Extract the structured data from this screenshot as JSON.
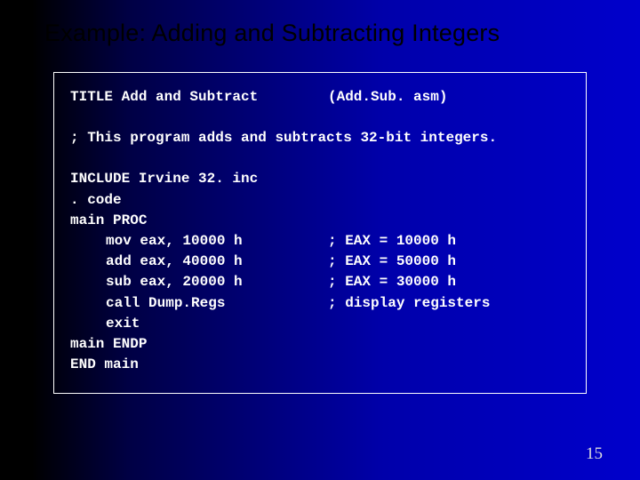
{
  "title": "Example: Adding and Subtracting Integers",
  "code": {
    "line1": {
      "left": "TITLE Add and Subtract",
      "right": "(Add.Sub. asm)"
    },
    "line2": "; This program adds and subtracts 32-bit integers.",
    "line3": "INCLUDE Irvine 32. inc",
    "line4": ". code",
    "line5": "main PROC",
    "line6": {
      "left": "mov eax, 10000 h",
      "right": "; EAX = 10000 h"
    },
    "line7": {
      "left": "add eax, 40000 h",
      "right": "; EAX = 50000 h"
    },
    "line8": {
      "left": "sub eax, 20000 h",
      "right": "; EAX = 30000 h"
    },
    "line9": {
      "left": "call Dump.Regs",
      "right": "; display registers"
    },
    "line10": "exit",
    "line11": "main ENDP",
    "line12": "END main"
  },
  "page_number": "15"
}
